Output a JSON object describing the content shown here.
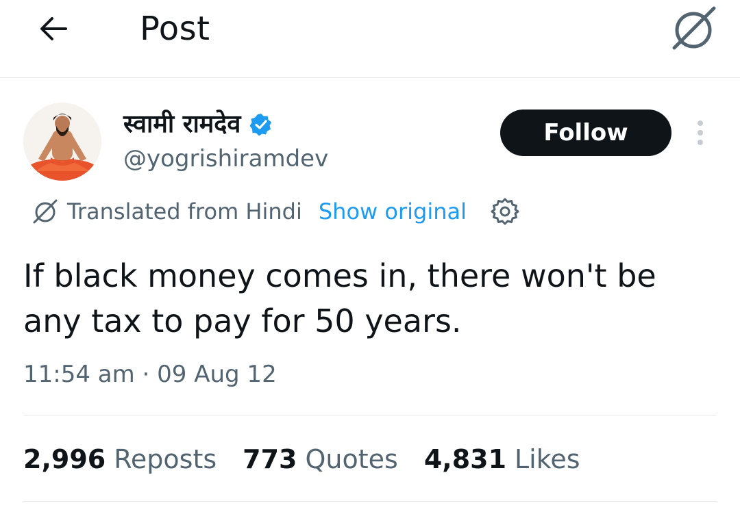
{
  "header": {
    "title": "Post",
    "back_icon": "arrow-left-icon",
    "translate_icon": "translate-icon"
  },
  "author": {
    "display_name": "स्वामी रामदेव",
    "handle": "@yogrishiramdev",
    "verified": true,
    "verified_color": "#1d9bf0"
  },
  "follow_button": {
    "label": "Follow"
  },
  "translation": {
    "label": "Translated from Hindi",
    "show_original": "Show original"
  },
  "tweet": {
    "text": "If black money comes in, there won't be any tax to pay for 50 years.",
    "timestamp": "11:54 am · 09 Aug 12"
  },
  "stats": [
    {
      "count": "2,996",
      "label": "Reposts"
    },
    {
      "count": "773",
      "label": "Quotes"
    },
    {
      "count": "4,831",
      "label": "Likes"
    }
  ],
  "colors": {
    "text_primary": "#0f1419",
    "text_secondary": "#536471",
    "accent": "#1d9bf0",
    "follow_bg": "#0f1419"
  }
}
